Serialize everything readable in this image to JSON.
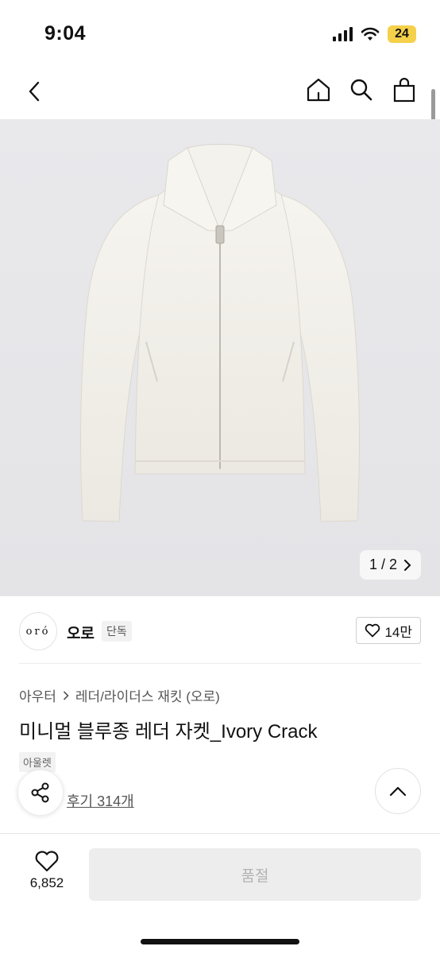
{
  "status": {
    "time": "9:04",
    "battery": "24"
  },
  "icons": {
    "back": "chevron-left-icon",
    "home": "home-icon",
    "search": "search-icon",
    "cart": "shopping-bag-icon",
    "heart": "heart-icon",
    "share": "share-icon",
    "top": "chevron-up-icon"
  },
  "gallery": {
    "pager": "1 / 2"
  },
  "brand": {
    "logo": "oró",
    "name": "오로",
    "badge": "단독",
    "likes": "14만"
  },
  "product": {
    "breadcrumb": [
      "아우터",
      "레더/라이더스 재킷 (오로)"
    ],
    "title": "미니멀 블루종 레더 자켓_Ivory Crack",
    "tag": "아울렛",
    "reviews": "후기 314개"
  },
  "bottom": {
    "wish_count": "6,852",
    "buy_label": "품절"
  },
  "colors": {
    "sold_out_bg": "#ededed",
    "battery": "#f5d04a",
    "jacket": "#f3f1ec"
  }
}
